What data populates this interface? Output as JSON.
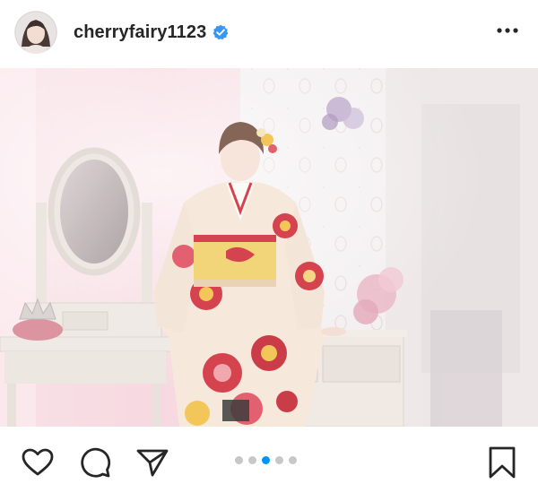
{
  "post": {
    "username": "cherryfairy1123",
    "verified": true,
    "avatar_icon": "profile-avatar",
    "more_icon": "more-options-icon"
  },
  "carousel": {
    "total": 5,
    "active_index": 2
  },
  "actions": {
    "like_icon": "heart-icon",
    "comment_icon": "comment-icon",
    "share_icon": "send-icon",
    "save_icon": "bookmark-icon"
  },
  "colors": {
    "text": "#262626",
    "verified_blue": "#3897f0",
    "dot_active": "#0095f6",
    "dot_inactive": "#c7c7c7"
  }
}
